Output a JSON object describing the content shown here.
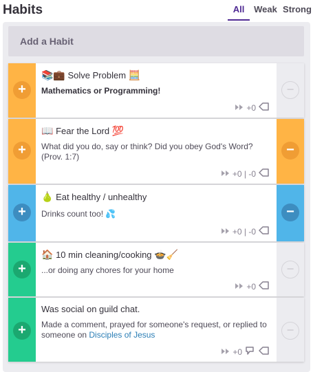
{
  "header": {
    "title": "Habits",
    "tabs": [
      {
        "label": "All",
        "active": true
      },
      {
        "label": "Weak",
        "active": false
      },
      {
        "label": "Strong",
        "active": false
      }
    ]
  },
  "add_habit": {
    "placeholder": "Add a Habit"
  },
  "colors": {
    "orange": "#ffb445",
    "orange_dark": "#f09d34",
    "blue": "#50b5e9",
    "blue_dark": "#3d8dc0",
    "green": "#24cc8f",
    "green_dark": "#1ba870",
    "disabled": "#ececf0"
  },
  "habits": [
    {
      "title_prefix": "📚💼",
      "title": "Solve Problem",
      "title_suffix": "🧮",
      "notes": "Mathematics or Programming!",
      "counter": "+0",
      "left_color": "orange",
      "right_color": "disabled"
    },
    {
      "title_prefix": "📖",
      "title": "Fear the Lord",
      "title_suffix": "💯",
      "notes": "What did you do, say or think? Did you obey God's Word? (Prov. 1:7)",
      "counter": "+0 | -0",
      "left_color": "orange",
      "right_color": "orange"
    },
    {
      "title_prefix": "🍐",
      "title": "Eat healthy / unhealthy",
      "title_suffix": "",
      "notes": "Drinks count too! 💦",
      "counter": "+0 | -0",
      "left_color": "blue",
      "right_color": "blue"
    },
    {
      "title_prefix": "🏠",
      "title": "10 min cleaning/cooking",
      "title_suffix": "🍲🧹",
      "notes": "...or doing any chores for your home",
      "counter": "+0",
      "left_color": "green",
      "right_color": "disabled"
    },
    {
      "title_prefix": "",
      "title": "Was social on guild chat.",
      "title_suffix": "",
      "notes": "Made a comment, prayed for someone's request, or replied to someone on",
      "notes_link": "Disciples of Jesus",
      "counter": "+0",
      "left_color": "green",
      "right_color": "disabled"
    }
  ]
}
